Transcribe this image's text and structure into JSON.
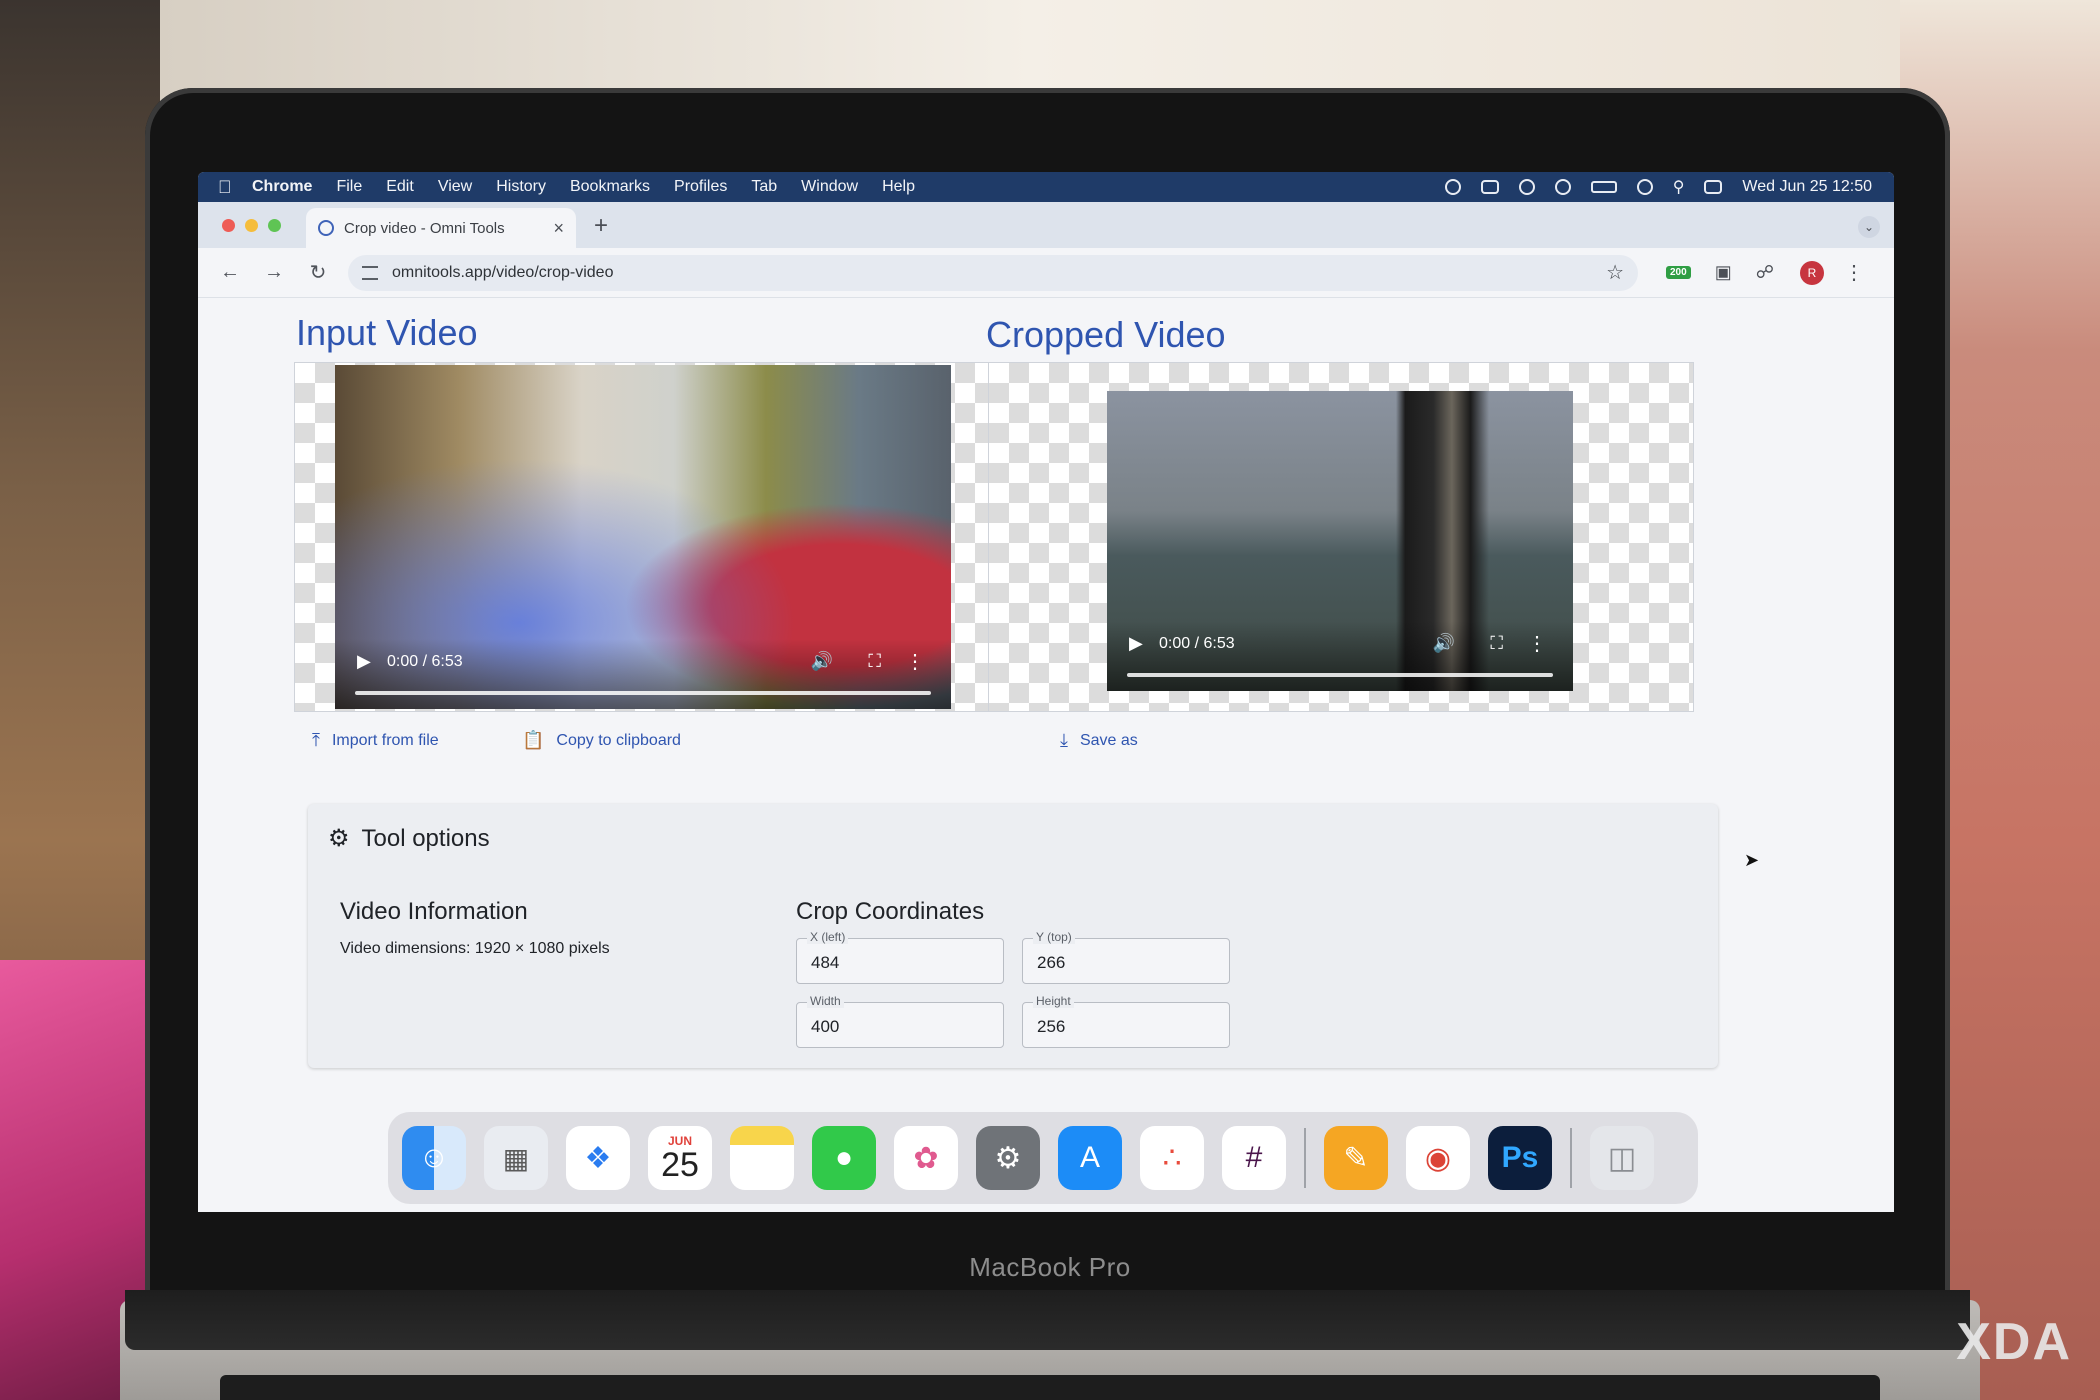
{
  "menubar": {
    "apple_icon": "apple-icon",
    "items": [
      "Chrome",
      "File",
      "Edit",
      "View",
      "History",
      "Bookmarks",
      "Profiles",
      "Tab",
      "Window",
      "Help"
    ],
    "clock": "Wed Jun 25  12:50"
  },
  "browser": {
    "tab_title": "Crop video - Omni Tools",
    "tab_close": "×",
    "new_tab": "+",
    "url": "omnitools.app/video/crop-video",
    "ext_badge": "200",
    "profile_initial": "R"
  },
  "page": {
    "input_title": "Input Video",
    "output_title": "Cropped Video",
    "input_time": "0:00 / 6:53",
    "output_time": "0:00 / 6:53",
    "import_label": "Import from file",
    "copy_label": "Copy to clipboard",
    "save_label": "Save as",
    "tool_options_title": "Tool options",
    "video_info_title": "Video Information",
    "video_dimensions": "Video dimensions: 1920 × 1080 pixels",
    "crop_title": "Crop Coordinates",
    "fields": {
      "x_label": "X (left)",
      "x_value": "484",
      "y_label": "Y (top)",
      "y_value": "266",
      "width_label": "Width",
      "width_value": "400",
      "height_label": "Height",
      "height_value": "256"
    }
  },
  "dock": {
    "calendar_month": "JUN",
    "calendar_day": "25",
    "ps_label": "Ps"
  },
  "device": {
    "brand": "MacBook Pro",
    "watermark": "XDA"
  },
  "colors": {
    "accent": "#2f55b0",
    "menubar": "#1f3b68"
  }
}
